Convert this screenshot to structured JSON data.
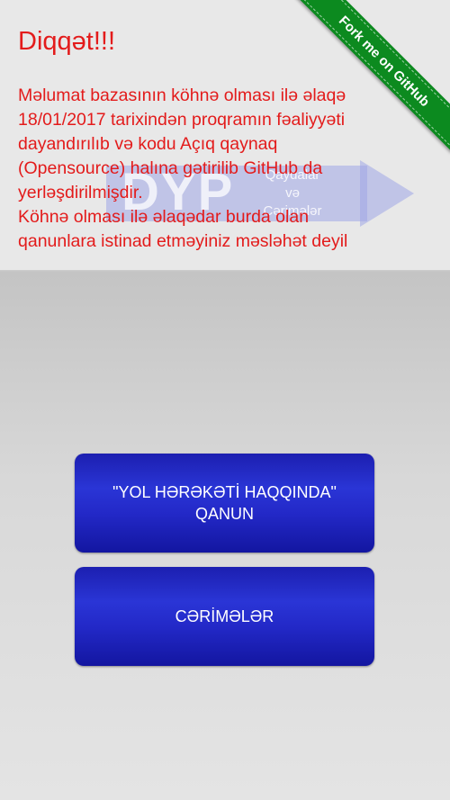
{
  "notice": {
    "title": "Diqqət!!!",
    "text": "Məlumat bazasının köhnə olması ilə əlaqə\n18/01/2017 tarixindən proqramın fəaliyyəti\ndayandırılıb və kodu Açıq qaynaq\n(Opensource) halına gətirilib GitHub da\nyerləşdirilmişdir.\nKöhnə olması ilə əlaqədar burda olan\nqanunlara istinad etməyiniz məsləhət deyil"
  },
  "watermark": {
    "logo": "DYP",
    "subtitle": "Qaydalar\nvə\nCərimələr"
  },
  "github_ribbon": {
    "label": "Fork me on GitHub",
    "color": "#0c8a1f"
  },
  "buttons": {
    "law_label": "\"YOL HƏRƏKƏTİ HAQQINDA\"\nQANUN",
    "fines_label": "CƏRİMƏLƏR"
  },
  "colors": {
    "warning_text": "#e31b1b",
    "button_bg": "#2329c8"
  }
}
